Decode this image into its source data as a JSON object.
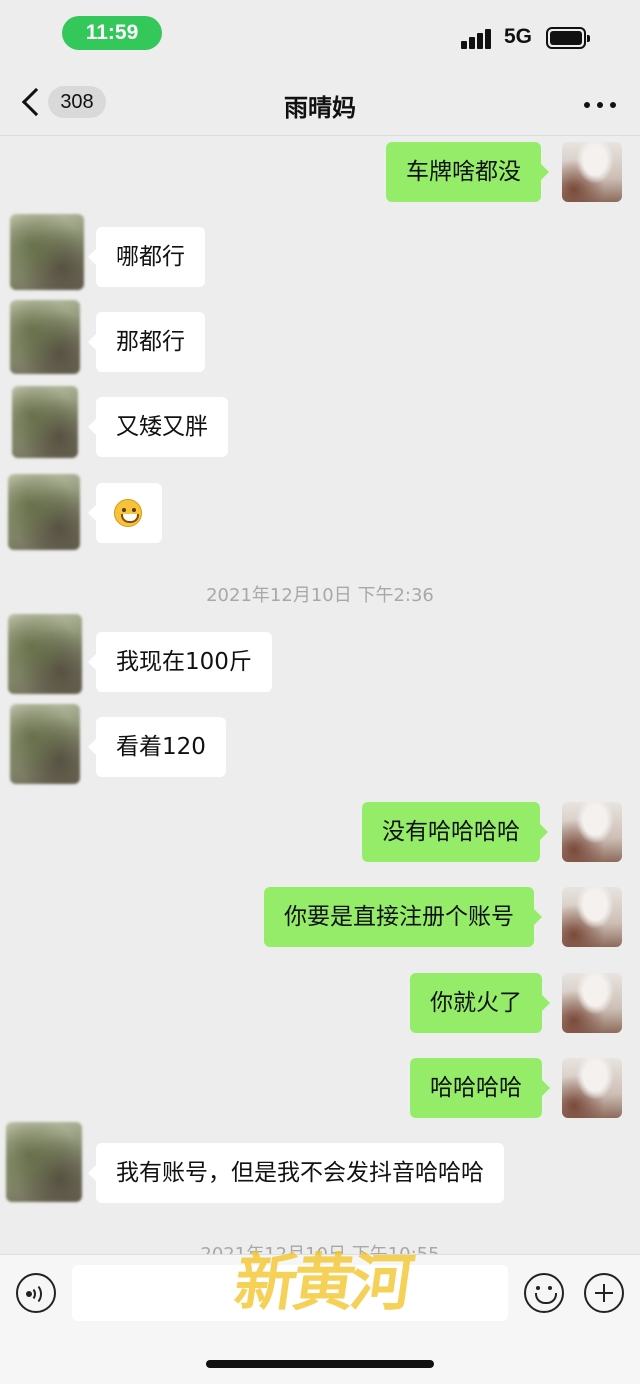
{
  "status_bar": {
    "time": "11:59",
    "network": "5G",
    "icons": [
      "signal-bars-icon",
      "battery-icon"
    ]
  },
  "nav": {
    "back_icon": "chevron-left-icon",
    "unread_count": "308",
    "title": "雨晴妈",
    "more_icon": "ellipsis-icon"
  },
  "colors": {
    "background": "#ededed",
    "outgoing_bubble": "#95ec69",
    "incoming_bubble": "#ffffff",
    "time_pill": "#34c759",
    "timestamp_text": "#a8a8a8"
  },
  "messages": [
    {
      "side": "out",
      "text": "车牌啥都没"
    },
    {
      "side": "in",
      "text": "哪都行"
    },
    {
      "side": "in",
      "text": "那都行"
    },
    {
      "side": "in",
      "text": "又矮又胖"
    },
    {
      "side": "in",
      "text": "",
      "emoji": "grinning-face-emoji"
    },
    {
      "side": "in",
      "text": "我现在100斤"
    },
    {
      "side": "in",
      "text": "看着120"
    },
    {
      "side": "out",
      "text": "没有哈哈哈哈"
    },
    {
      "side": "out",
      "text": "你要是直接注册个账号"
    },
    {
      "side": "out",
      "text": "你就火了"
    },
    {
      "side": "out",
      "text": "哈哈哈哈"
    },
    {
      "side": "in",
      "text": "我有账号，但是我不会发抖音哈哈哈"
    }
  ],
  "timestamps": [
    "2021年12月10日 下午2:36",
    "2021年12月10日 下午10:55"
  ],
  "input_bar": {
    "voice_icon": "voice-icon",
    "emoji_icon": "emoji-icon",
    "plus_icon": "plus-icon",
    "placeholder": ""
  },
  "watermark": "新黄河"
}
